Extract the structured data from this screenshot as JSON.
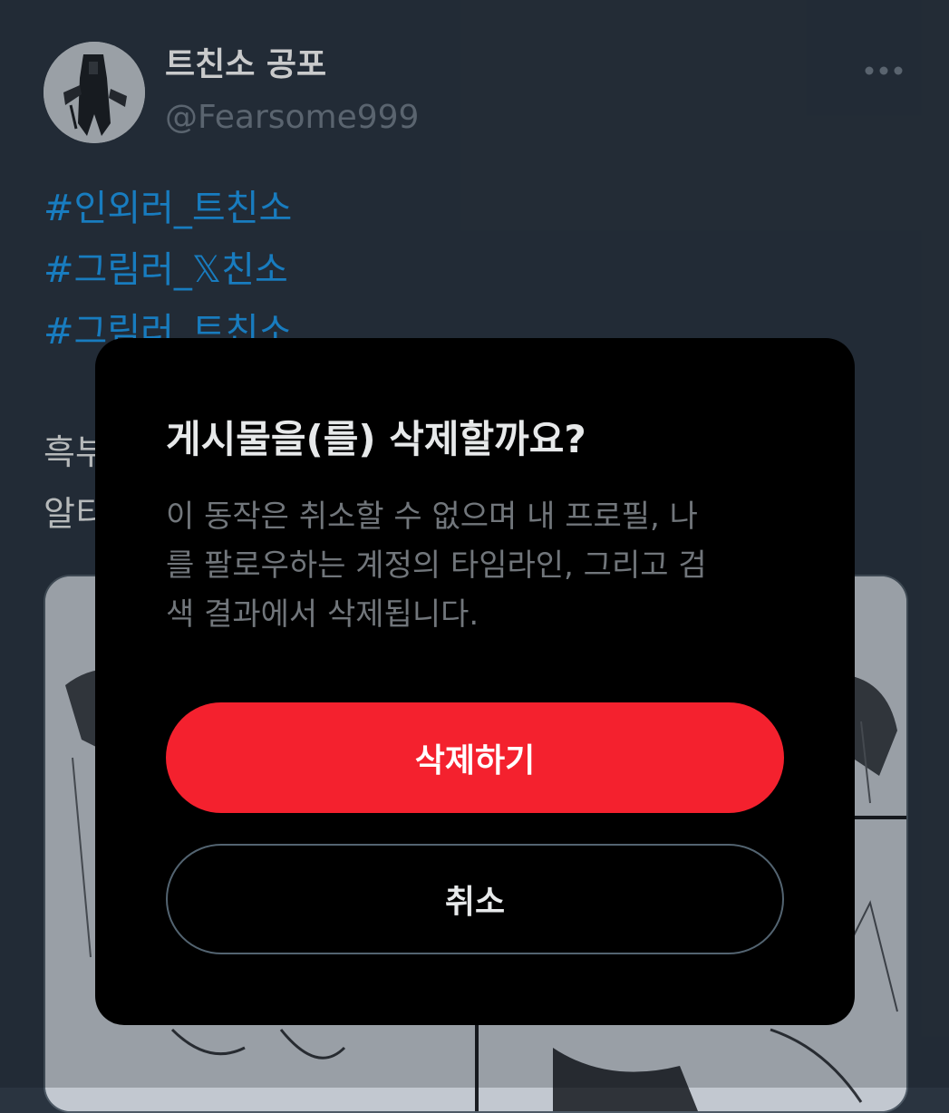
{
  "tweet": {
    "display_name": "트친소 공포",
    "handle": "@Fearsome999",
    "more_icon": "more-horizontal-icon",
    "hashtags": [
      "#인외러_트친소",
      "#그림러_𝕏친소",
      "#그림러_트친소"
    ],
    "body_lines": [
      "흑부",
      "알티"
    ]
  },
  "dialog": {
    "title": "게시물을(를) 삭제할까요?",
    "description_lines": [
      "이 동작은 취소할 수 없으며 내 프로필, 나",
      "를 팔로우하는 계정의 타임라인, 그리고 검",
      "색 결과에서 삭제됩니다."
    ],
    "delete_label": "삭제하기",
    "cancel_label": "취소",
    "delete_color": "#f4212e"
  }
}
